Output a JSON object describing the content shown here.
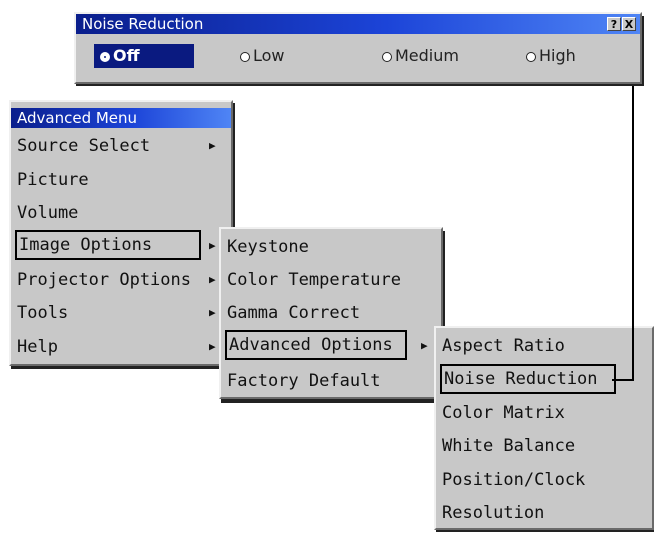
{
  "noise_dialog": {
    "title": "Noise Reduction",
    "help_button": "?",
    "close_button": "X",
    "options": [
      {
        "label": "Off",
        "selected": true
      },
      {
        "label": "Low",
        "selected": false
      },
      {
        "label": "Medium",
        "selected": false
      },
      {
        "label": "High",
        "selected": false
      }
    ]
  },
  "advanced_menu": {
    "title": "Advanced Menu",
    "items": [
      {
        "label": "Source Select",
        "has_submenu": true
      },
      {
        "label": "Picture",
        "has_submenu": false
      },
      {
        "label": "Volume",
        "has_submenu": false
      },
      {
        "label": "Image Options",
        "has_submenu": true,
        "highlighted": true
      },
      {
        "label": "Projector Options",
        "has_submenu": true
      },
      {
        "label": "Tools",
        "has_submenu": true
      },
      {
        "label": "Help",
        "has_submenu": true
      }
    ]
  },
  "image_options_menu": {
    "items": [
      {
        "label": "Keystone"
      },
      {
        "label": "Color Temperature"
      },
      {
        "label": "Gamma Correct"
      },
      {
        "label": "Advanced Options",
        "has_submenu": true,
        "highlighted": true
      },
      {
        "label": "Factory Default"
      }
    ]
  },
  "advanced_options_menu": {
    "items": [
      {
        "label": "Aspect Ratio"
      },
      {
        "label": "Noise Reduction",
        "highlighted": true
      },
      {
        "label": "Color Matrix"
      },
      {
        "label": "White Balance"
      },
      {
        "label": "Position/Clock"
      },
      {
        "label": "Resolution"
      }
    ]
  },
  "submenu_arrow": "▶",
  "colors": {
    "menu_bg": "#c8c8c8",
    "title_start": "#0a1e8c",
    "title_end": "#4f85f5",
    "selected_bg": "#0a1a80"
  }
}
